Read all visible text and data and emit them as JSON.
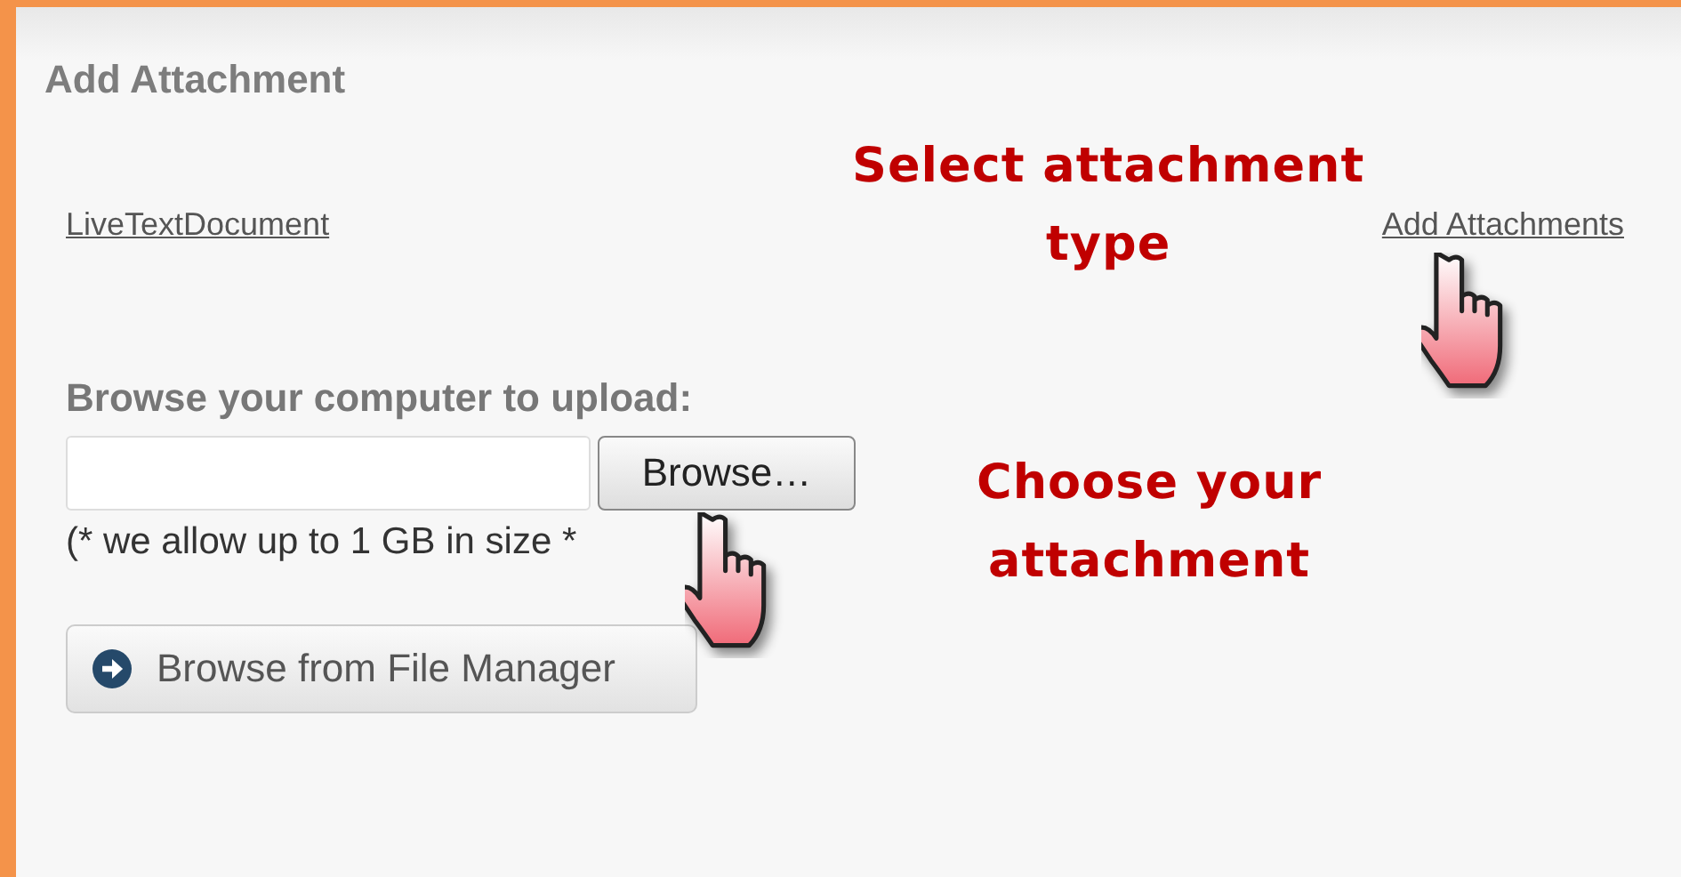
{
  "panel": {
    "title": "Add Attachment"
  },
  "attachment_types": [
    {
      "label": "LiveTextDocument"
    },
    {
      "label": "Add Attachments"
    }
  ],
  "upload": {
    "label": "Browse your computer to upload:",
    "browse_button": "Browse…",
    "note": "(* we allow up to 1 GB in size *"
  },
  "file_manager_button": {
    "label": "Browse from File Manager"
  },
  "annotations": [
    {
      "lines": [
        "Select attachment",
        "type"
      ]
    },
    {
      "lines": [
        "Choose your",
        "attachment"
      ]
    }
  ]
}
